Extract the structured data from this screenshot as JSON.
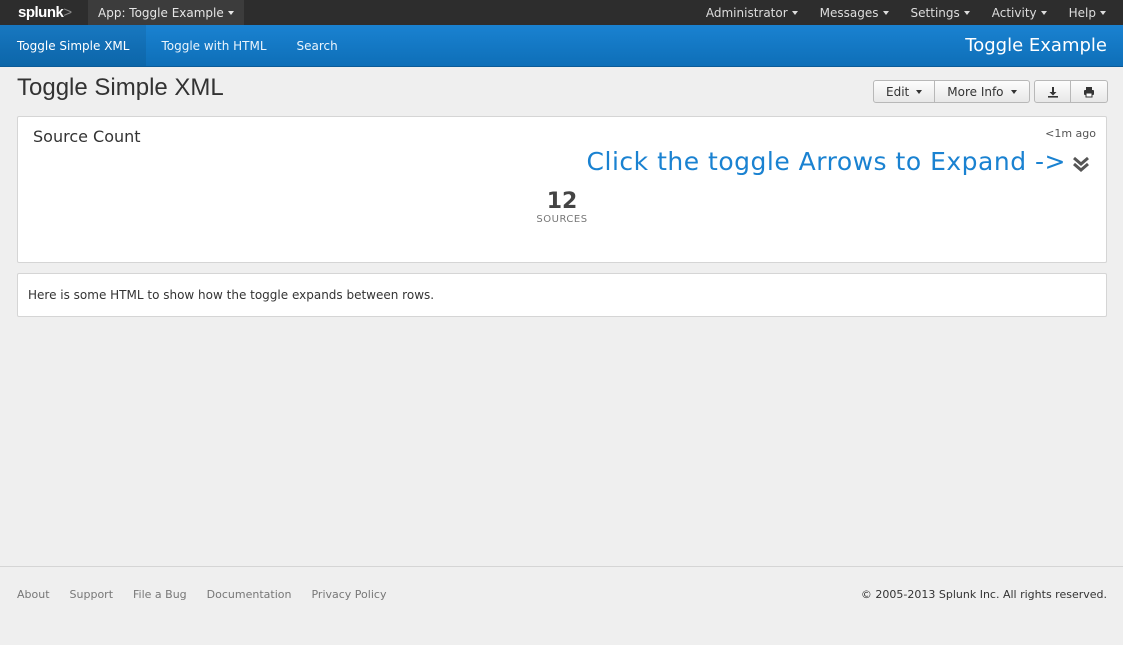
{
  "topbar": {
    "logo_text": "splunk",
    "logo_suffix": ">",
    "app_menu": "App: Toggle Example",
    "menu": [
      "Administrator",
      "Messages",
      "Settings",
      "Activity",
      "Help"
    ]
  },
  "nav": {
    "tabs": [
      "Toggle Simple XML",
      "Toggle with HTML",
      "Search"
    ],
    "app_title": "Toggle Example"
  },
  "header": {
    "title": "Toggle Simple XML",
    "edit_label": "Edit",
    "more_info_label": "More Info",
    "export_icon": "download-icon",
    "print_icon": "print-icon"
  },
  "panel1": {
    "title": "Source Count",
    "timestamp": "<1m ago",
    "toggle_message": "Click the toggle Arrows to Expand ->",
    "value": "12",
    "value_label": "SOURCES"
  },
  "panel2": {
    "text": "Here is some HTML to show how the toggle expands between rows."
  },
  "footer": {
    "links": [
      "About",
      "Support",
      "File a Bug",
      "Documentation",
      "Privacy Policy"
    ],
    "copyright": "© 2005-2013 Splunk Inc. All rights reserved."
  },
  "colors": {
    "accent": "#1a82d1",
    "topbar": "#2d2d2d"
  }
}
